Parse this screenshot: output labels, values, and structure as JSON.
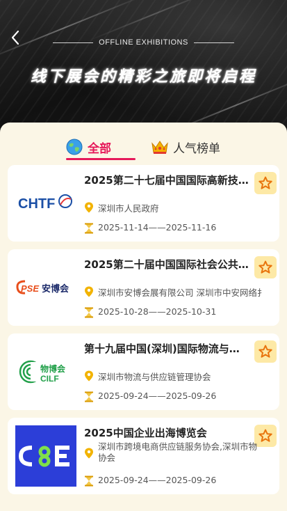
{
  "header": {
    "back_icon": "chevron-left-icon",
    "subtitle": "OFFLINE EXHIBITIONS",
    "title": "线下展会的精彩之旅即将启程"
  },
  "tabs": [
    {
      "label": "全部",
      "icon": "globe-icon",
      "active": true
    },
    {
      "label": "人气榜单",
      "icon": "crown-icon",
      "active": false
    }
  ],
  "colors": {
    "accent": "#e6195a",
    "background": "#fbf6e6",
    "star_bg": "#fde9a6",
    "pin": "#f2b300"
  },
  "exhibitions": [
    {
      "title": "2025第二十七届中国国际高新技…",
      "organizer": "深圳市人民政府",
      "dates": "2025-11-14——2025-11-16",
      "logo_text": "CHTF"
    },
    {
      "title": "2025第二十届中国国际社会公共…",
      "organizer": "深圳市安博会展有限公司 深圳市中安网络扌",
      "dates": "2025-10-28——2025-10-31",
      "logo_text": "CPSE安博会"
    },
    {
      "title": "第十九届中国(深圳)国际物流与…",
      "organizer": "深圳市物流与供应链管理协会",
      "dates": "2025-09-24——2025-09-26",
      "logo_text": "物博会",
      "logo_sub": "CILF"
    },
    {
      "title": "2025中国企业出海博览会",
      "organizer": "深圳市跨境电商供应链服务协会,深圳市物协会",
      "dates": "2025-09-24——2025-09-26",
      "logo_text": "CBE"
    }
  ]
}
